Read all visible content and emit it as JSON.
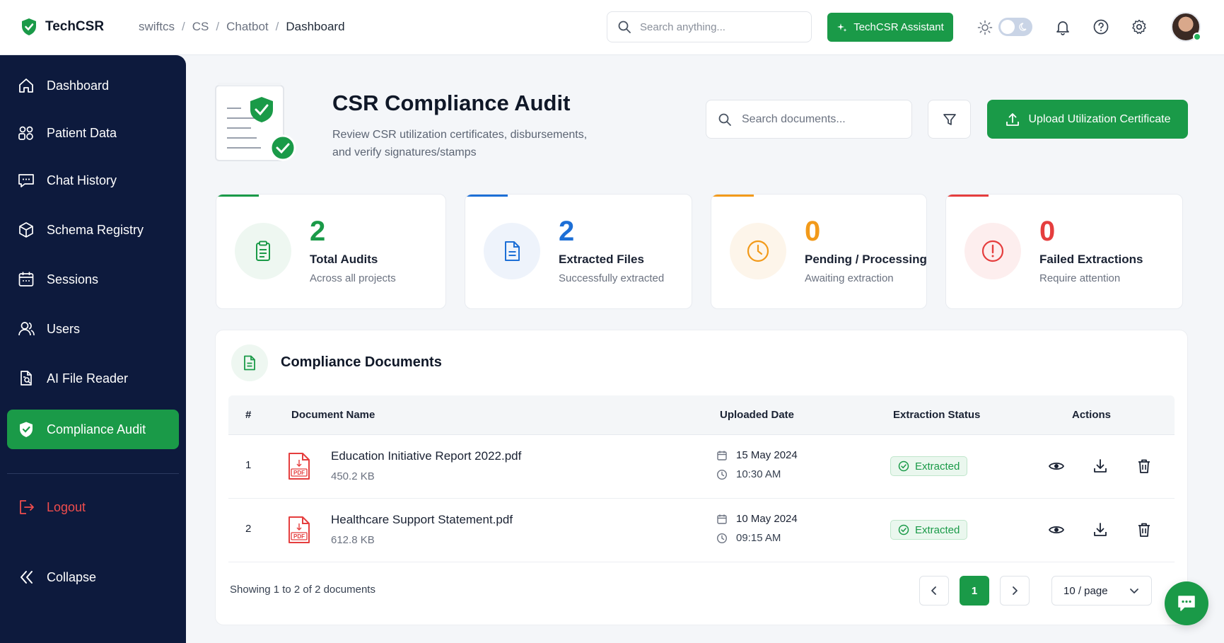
{
  "brand": {
    "name": "TechCSR"
  },
  "breadcrumb": [
    "swiftcs",
    "CS",
    "Chatbot",
    "Dashboard"
  ],
  "top_search": {
    "placeholder": "Search anything..."
  },
  "assistant_button": {
    "label": "TechCSR Assistant"
  },
  "sidebar": {
    "items": [
      {
        "label": "Dashboard",
        "icon": "home-icon"
      },
      {
        "label": "Patient Data",
        "icon": "users-group-icon"
      },
      {
        "label": "Chat History",
        "icon": "chat-icon"
      },
      {
        "label": "Schema Registry",
        "icon": "cube-icon"
      },
      {
        "label": "Sessions",
        "icon": "calendar-icon"
      },
      {
        "label": "Users",
        "icon": "users-icon"
      },
      {
        "label": "AI File Reader",
        "icon": "file-search-icon"
      },
      {
        "label": "Compliance Audit",
        "icon": "shield-check-icon",
        "active": true
      }
    ],
    "logout_label": "Logout",
    "collapse_label": "Collapse"
  },
  "page": {
    "title": "CSR Compliance Audit",
    "description": "Review CSR utilization certificates, disbursements, and verify signatures/stamps",
    "doc_search_placeholder": "Search documents...",
    "upload_label": "Upload Utilization Certificate"
  },
  "stats": [
    {
      "value": "2",
      "label": "Total Audits",
      "sub": "Across all projects",
      "color": "#1a9a48",
      "icon": "clipboard-icon"
    },
    {
      "value": "2",
      "label": "Extracted Files",
      "sub": "Successfully extracted",
      "color": "#1d6fd6",
      "icon": "file-text-icon"
    },
    {
      "value": "0",
      "label": "Pending / Processing",
      "sub": "Awaiting extraction",
      "color": "#f29a1a",
      "icon": "clock-icon"
    },
    {
      "value": "0",
      "label": "Failed Extractions",
      "sub": "Require attention",
      "color": "#e53e3e",
      "icon": "alert-icon"
    }
  ],
  "documents": {
    "title": "Compliance Documents",
    "columns": [
      "#",
      "Document Name",
      "Uploaded Date",
      "Extraction Status",
      "Actions"
    ],
    "rows": [
      {
        "num": "1",
        "name": "Education Initiative Report 2022.pdf",
        "size": "450.2 KB",
        "date": "15 May 2024",
        "time": "10:30 AM",
        "status": "Extracted"
      },
      {
        "num": "2",
        "name": "Healthcare Support Statement.pdf",
        "size": "612.8 KB",
        "date": "10 May 2024",
        "time": "09:15 AM",
        "status": "Extracted"
      }
    ],
    "footer": "Showing 1 to 2 of 2 documents",
    "current_page": "1",
    "per_page": "10 / page"
  },
  "colors": {
    "accent": "#1a9a48",
    "sidebar": "#0d1a3d"
  }
}
